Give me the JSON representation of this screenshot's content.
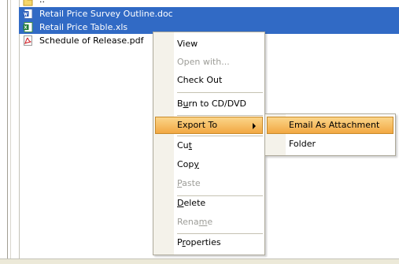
{
  "files": [
    {
      "name": "..",
      "icon": "up-folder-icon",
      "selected": false,
      "partial": true
    },
    {
      "name": "Retail Price Survey Outline.doc",
      "icon": "word-doc-icon",
      "selected": true
    },
    {
      "name": "Retail Price Table.xls",
      "icon": "excel-xls-icon",
      "selected": true
    },
    {
      "name": "Schedule of Release.pdf",
      "icon": "pdf-icon",
      "selected": false
    }
  ],
  "context_menu": {
    "view": "View",
    "open_with": "Open with...",
    "check_out": "Check Out",
    "burn_pre": "B",
    "burn_u": "u",
    "burn_post": "rn to CD/DVD",
    "export_to": "Export To",
    "cut_pre": "Cu",
    "cut_u": "t",
    "copy_pre": "Cop",
    "copy_u": "y",
    "paste_u": "P",
    "paste_post": "aste",
    "delete_u": "D",
    "delete_post": "elete",
    "rename_pre": "Rena",
    "rename_u": "m",
    "rename_post": "e",
    "props_pre": "P",
    "props_u": "r",
    "props_post": "operties"
  },
  "submenu": {
    "email": "Email As Attachment",
    "folder": "Folder"
  },
  "colors": {
    "selection": "#316ac5",
    "menu_hover": "#f2a842",
    "disabled_text": "#9d9d98"
  }
}
